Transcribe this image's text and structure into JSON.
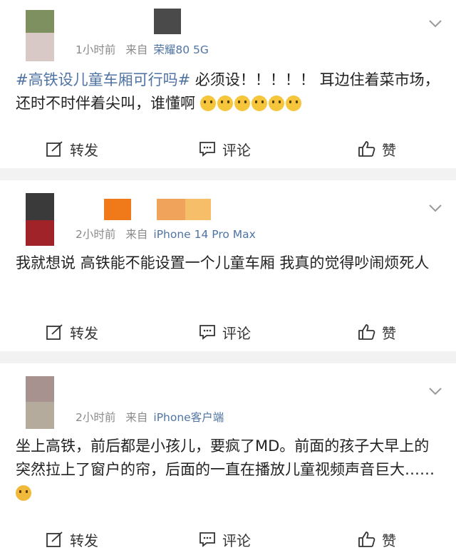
{
  "posts": [
    {
      "time": "1小时前",
      "from_label": "来自",
      "source": "荣耀80 5G",
      "topic": "#高铁设儿童车厢可行吗#",
      "content": "必须设！！！！！ 耳边住着菜市场，还时不时伴着尖叫，谁懂啊",
      "emoji_icons": [
        "crying-face-icon",
        "crying-face-icon",
        "crying-face-icon",
        "crying-face-icon",
        "crying-face-icon",
        "crying-face-icon"
      ],
      "actions": {
        "repost": "转发",
        "comment": "评论",
        "like": "赞"
      }
    },
    {
      "time": "2小时前",
      "from_label": "来自",
      "source": "iPhone 14 Pro Max",
      "content": "我就想说 高铁能不能设置一个儿童车厢 我真的觉得吵闹烦死人",
      "actions": {
        "repost": "转发",
        "comment": "评论",
        "like": "赞"
      }
    },
    {
      "time": "2小时前",
      "from_label": "来自",
      "source": "iPhone客户端",
      "content": "坐上高铁，前后都是小孩儿，要疯了MD。前面的孩子大早上的突然拉上了窗户的帘，后面的一直在播放儿童视频声音巨大……",
      "emoji_icons": [
        "angry-face-icon"
      ],
      "actions": {
        "repost": "转发",
        "comment": "评论",
        "like": "赞"
      }
    }
  ],
  "colors": {
    "link": "#4f74a4",
    "meta": "#8a8a8a",
    "separator": "#f2f2f2"
  }
}
